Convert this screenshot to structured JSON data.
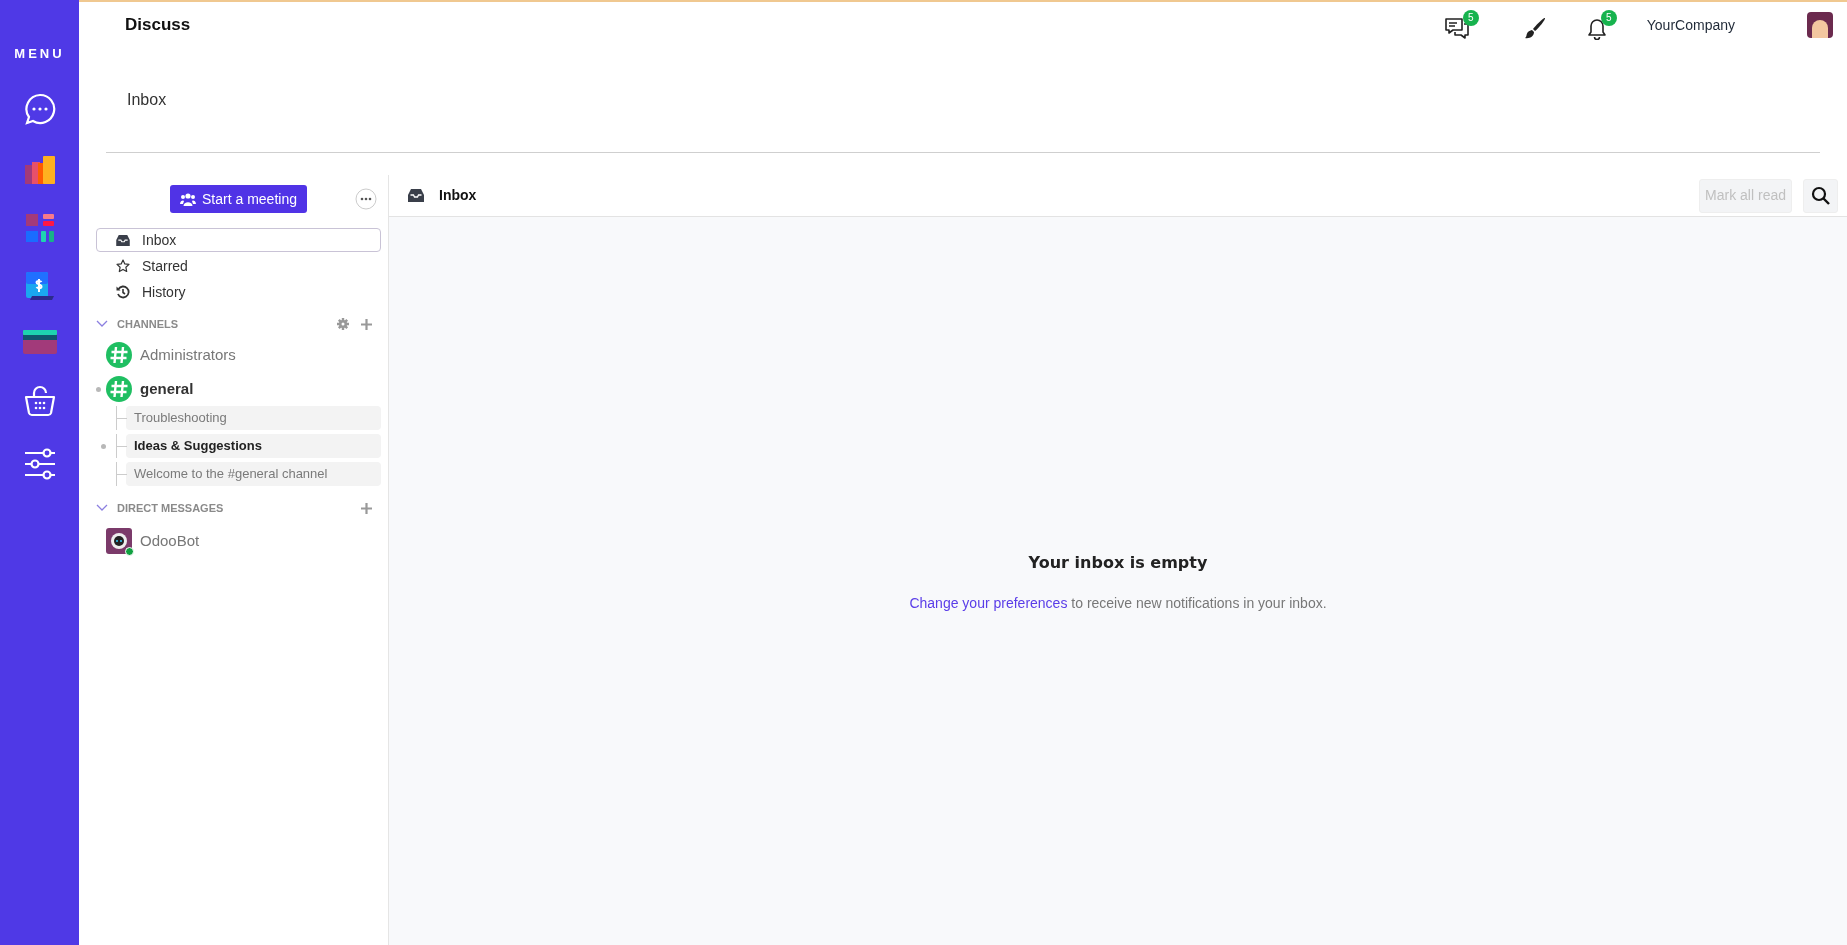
{
  "menu": {
    "title": "MENU"
  },
  "topbar": {
    "app": "Discuss",
    "systray": [
      {
        "kind": "messages",
        "badge": "5"
      },
      {
        "kind": "brush"
      },
      {
        "kind": "bell",
        "badge": "5"
      }
    ],
    "company": "YourCompany"
  },
  "breadcrumb": "Inbox",
  "sidebar": {
    "meeting_button": "Start a meeting",
    "mailboxes": [
      {
        "kind": "inbox",
        "label": "Inbox",
        "selected": true
      },
      {
        "kind": "starred",
        "label": "Starred",
        "selected": false
      },
      {
        "kind": "history",
        "label": "History",
        "selected": false
      }
    ],
    "channels": {
      "title": "CHANNELS",
      "expanded": true,
      "items": [
        {
          "name": "Administrators",
          "unread": false
        },
        {
          "name": "general",
          "unread": true,
          "children": [
            {
              "name": "Troubleshooting",
              "unread": false
            },
            {
              "name": "Ideas & Suggestions",
              "unread": true
            },
            {
              "name": "Welcome to the #general channel",
              "unread": false
            }
          ]
        }
      ]
    },
    "direct_messages": {
      "title": "DIRECT MESSAGES",
      "expanded": true,
      "items": [
        {
          "name": "OdooBot",
          "online": true
        }
      ]
    }
  },
  "thread": {
    "title": "Inbox",
    "mark_all_read": {
      "label": "Mark all read",
      "disabled": true
    },
    "empty_title": "Your inbox is empty",
    "link": "Change your preferences",
    "text": " to receive new notifications in your inbox."
  }
}
